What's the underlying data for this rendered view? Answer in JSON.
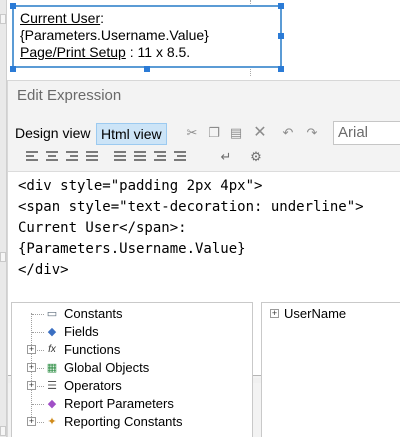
{
  "report_box": {
    "line1_label": "Current User",
    "line1_colon": ":",
    "line2": "{Parameters.Username.Value}",
    "line3_label": "Page/Print Setup",
    "line3_rest": " : 11 x 8.5."
  },
  "dialog": {
    "title": "Edit Expression",
    "tabs": {
      "design": "Design view",
      "html": "Html view"
    },
    "font_value": "Arial",
    "editor_text": "<div style=\"padding 2px 4px\">\n<span style=\"text-decoration: underline\">\nCurrent User</span>:\n{Parameters.Username.Value}\n</div>",
    "tree_left": [
      {
        "label": "Constants",
        "icon": "constants-icon",
        "expandable": false
      },
      {
        "label": "Fields",
        "icon": "fields-icon",
        "expandable": false
      },
      {
        "label": "Functions",
        "icon": "functions-icon",
        "expandable": true
      },
      {
        "label": "Global Objects",
        "icon": "global-objects-icon",
        "expandable": true
      },
      {
        "label": "Operators",
        "icon": "operators-icon",
        "expandable": true
      },
      {
        "label": "Report Parameters",
        "icon": "report-parameters-icon",
        "expandable": false
      },
      {
        "label": "Reporting Constants",
        "icon": "reporting-constants-icon",
        "expandable": true
      }
    ],
    "tree_right": [
      {
        "label": "UserName",
        "expandable": true
      }
    ]
  },
  "colors": {
    "selection_border": "#5b9bd5",
    "html_tab_bg": "#cce4f7",
    "report_params_icon": "#a04fc6"
  }
}
